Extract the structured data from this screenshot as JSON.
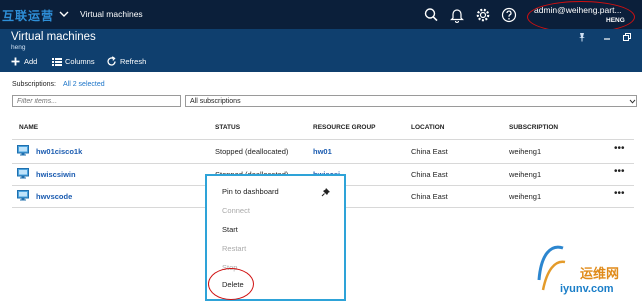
{
  "topbar": {
    "brand": "互联运营",
    "breadcrumb": "Virtual machines",
    "account_name": "admin@weiheng.part...",
    "account_tenant": "HENG"
  },
  "blade": {
    "title": "Virtual machines",
    "subtitle": "heng",
    "commands": {
      "add": "Add",
      "columns": "Columns",
      "refresh": "Refresh"
    }
  },
  "filters": {
    "subscriptions_label": "Subscriptions:",
    "subscriptions_link": "All 2 selected",
    "filter_placeholder": "Filter items...",
    "subscription_select": "All subscriptions"
  },
  "table": {
    "headers": {
      "name": "NAME",
      "status": "STATUS",
      "resource_group": "RESOURCE GROUP",
      "location": "LOCATION",
      "subscription": "SUBSCRIPTION"
    },
    "rows": [
      {
        "name": "hw01cisco1k",
        "status": "Stopped (deallocated)",
        "resource_group": "hw01",
        "location": "China East",
        "subscription": "weiheng1",
        "more": "•••"
      },
      {
        "name": "hwiscsiwin",
        "status": "Stopped (deallocated)",
        "resource_group": "hwiscsi",
        "location": "China East",
        "subscription": "weiheng1",
        "more": "•••"
      },
      {
        "name": "hwvscode",
        "status": "",
        "resource_group": "",
        "location": "China East",
        "subscription": "weiheng1",
        "more": "•••"
      }
    ]
  },
  "context_menu": {
    "pin": "Pin to dashboard",
    "connect": "Connect",
    "start": "Start",
    "restart": "Restart",
    "stop": "Stop",
    "delete": "Delete"
  },
  "watermark": {
    "line1": "运维网",
    "line2": "iyunv.com"
  },
  "colors": {
    "topbar": "#0b1f3a",
    "blade_header": "#0f3f6e",
    "link": "#1a5bb0",
    "menu_border": "#2ea3d8",
    "annotation": "#d01010"
  }
}
